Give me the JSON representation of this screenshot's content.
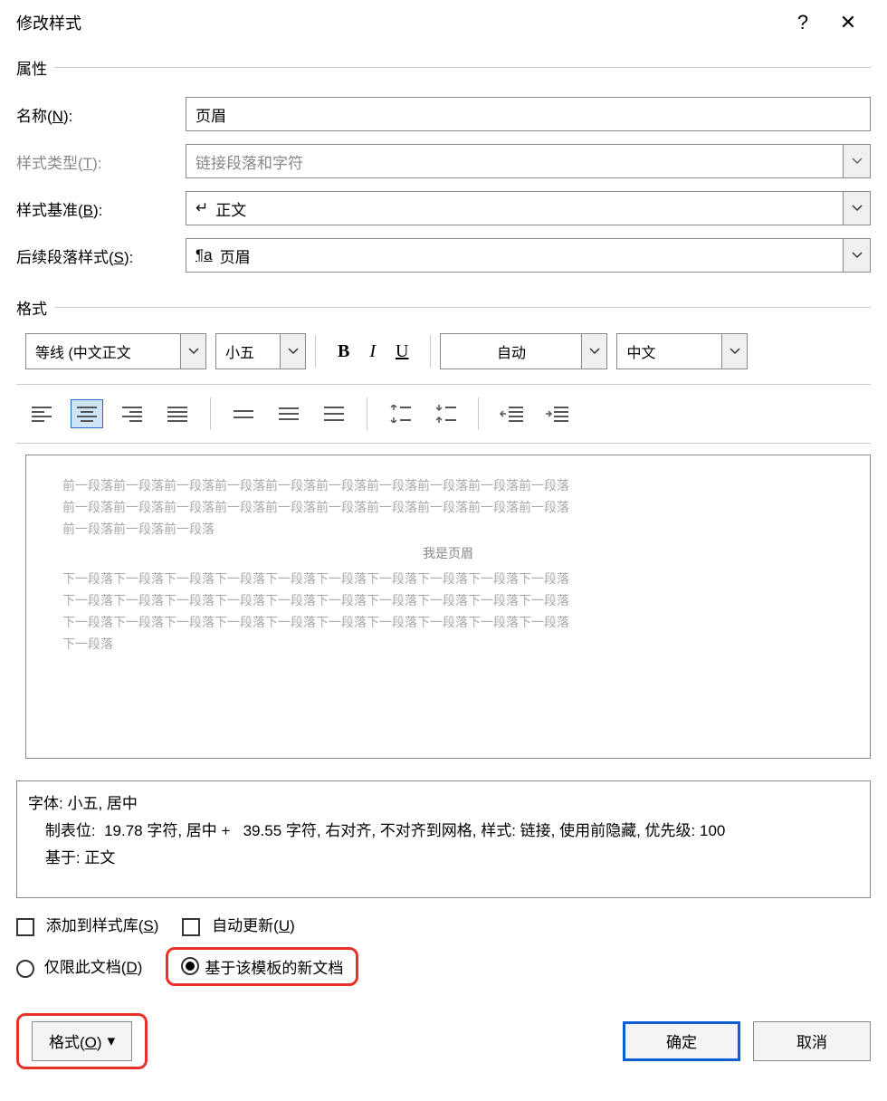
{
  "titlebar": {
    "title": "修改样式",
    "help": "?",
    "close": "✕"
  },
  "sections": {
    "properties": "属性",
    "format": "格式"
  },
  "form": {
    "name_label_pre": "名称(",
    "name_label_key": "N",
    "name_label_post": "):",
    "name_value": "页眉",
    "type_label_pre": "样式类型(",
    "type_label_key": "T",
    "type_label_post": "):",
    "type_value": "链接段落和字符",
    "based_label_pre": "样式基准(",
    "based_label_key": "B",
    "based_label_post": "):",
    "based_value": "正文",
    "based_icon": "↵",
    "follow_label_pre": "后续段落样式(",
    "follow_label_key": "S",
    "follow_label_post": "):",
    "follow_value": "页眉",
    "follow_icon": "¶a"
  },
  "format_toolbar": {
    "font": "等线 (中文正文",
    "size": "小五",
    "bold": "B",
    "italic": "I",
    "underline": "U",
    "color": "自动",
    "lang": "中文"
  },
  "preview": {
    "line_prev": "前一段落前一段落前一段落前一段落前一段落前一段落前一段落前一段落前一段落前一段落",
    "line_prev2": "前一段落前一段落前一段落",
    "sample": "我是页眉",
    "line_next": "下一段落下一段落下一段落下一段落下一段落下一段落下一段落下一段落下一段落下一段落",
    "line_next2": "下一段落"
  },
  "desc": {
    "line1": "字体: 小五, 居中",
    "line2_indent": "    制表位:  19.78 字符, 居中 +   39.55 字符, 右对齐, 不对齐到网格, 样式: 链接, 使用前隐藏, 优先级: 100",
    "line3_indent": "    基于: 正文"
  },
  "options": {
    "add_gallery_pre": "添加到样式库(",
    "add_gallery_key": "S",
    "add_gallery_post": ")",
    "auto_update_pre": "自动更新(",
    "auto_update_key": "U",
    "auto_update_post": ")",
    "this_doc_pre": "仅限此文档(",
    "this_doc_key": "D",
    "this_doc_post": ")",
    "template_doc": "基于该模板的新文档"
  },
  "footer": {
    "format_btn_pre": "格式(",
    "format_btn_key": "O",
    "format_btn_post": ")",
    "ok": "确定",
    "cancel": "取消"
  }
}
